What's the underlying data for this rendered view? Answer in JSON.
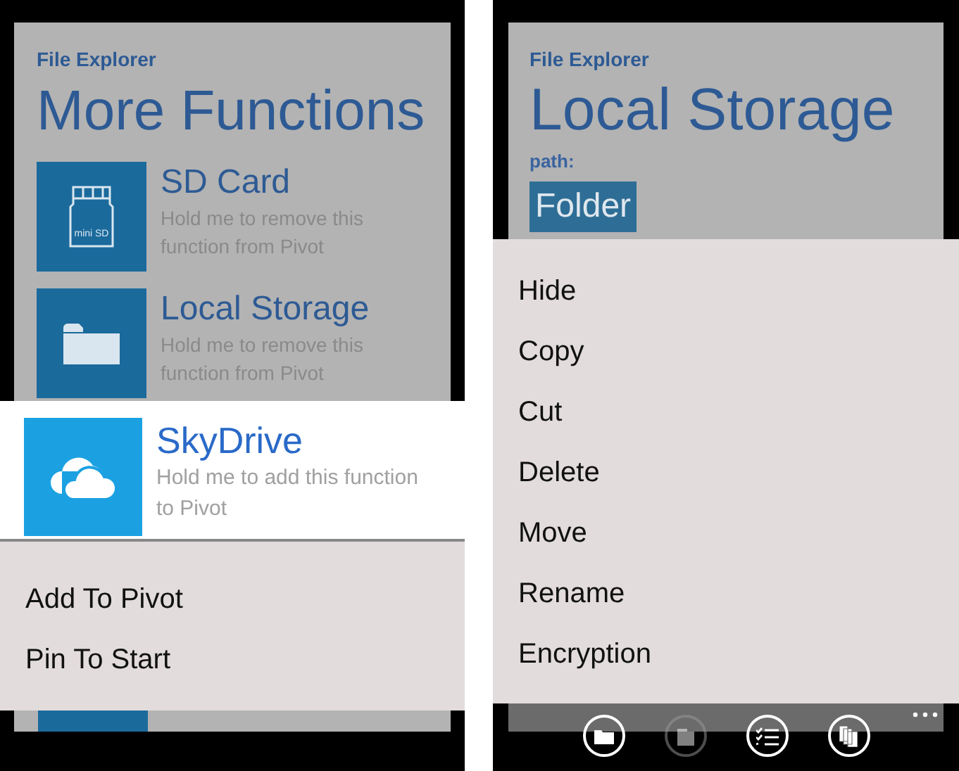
{
  "left": {
    "app_title": "File Explorer",
    "page_title": "More Functions",
    "functions": [
      {
        "kind": "sd-card",
        "icon_label": "mini SD",
        "title": "SD Card",
        "hint": "Hold me to remove this function from Pivot"
      },
      {
        "kind": "folder",
        "title": "Local Storage",
        "hint": "Hold me to remove this function from Pivot"
      }
    ],
    "highlighted": {
      "kind": "cloud",
      "title": "SkyDrive",
      "hint": "Hold me to add this function to Pivot"
    },
    "context_menu": [
      "Add To Pivot",
      "Pin To Start"
    ]
  },
  "right": {
    "app_title": "File Explorer",
    "page_title": "Local Storage",
    "path_label": "path:",
    "path_button": "Folder",
    "context_menu": [
      "Hide",
      "Copy",
      "Cut",
      "Delete",
      "Move",
      "Rename",
      "Encryption"
    ],
    "app_bar": [
      {
        "kind": "folder",
        "disabled": false
      },
      {
        "kind": "paste",
        "disabled": true
      },
      {
        "kind": "checklist",
        "disabled": false
      },
      {
        "kind": "pages",
        "disabled": false
      }
    ]
  }
}
